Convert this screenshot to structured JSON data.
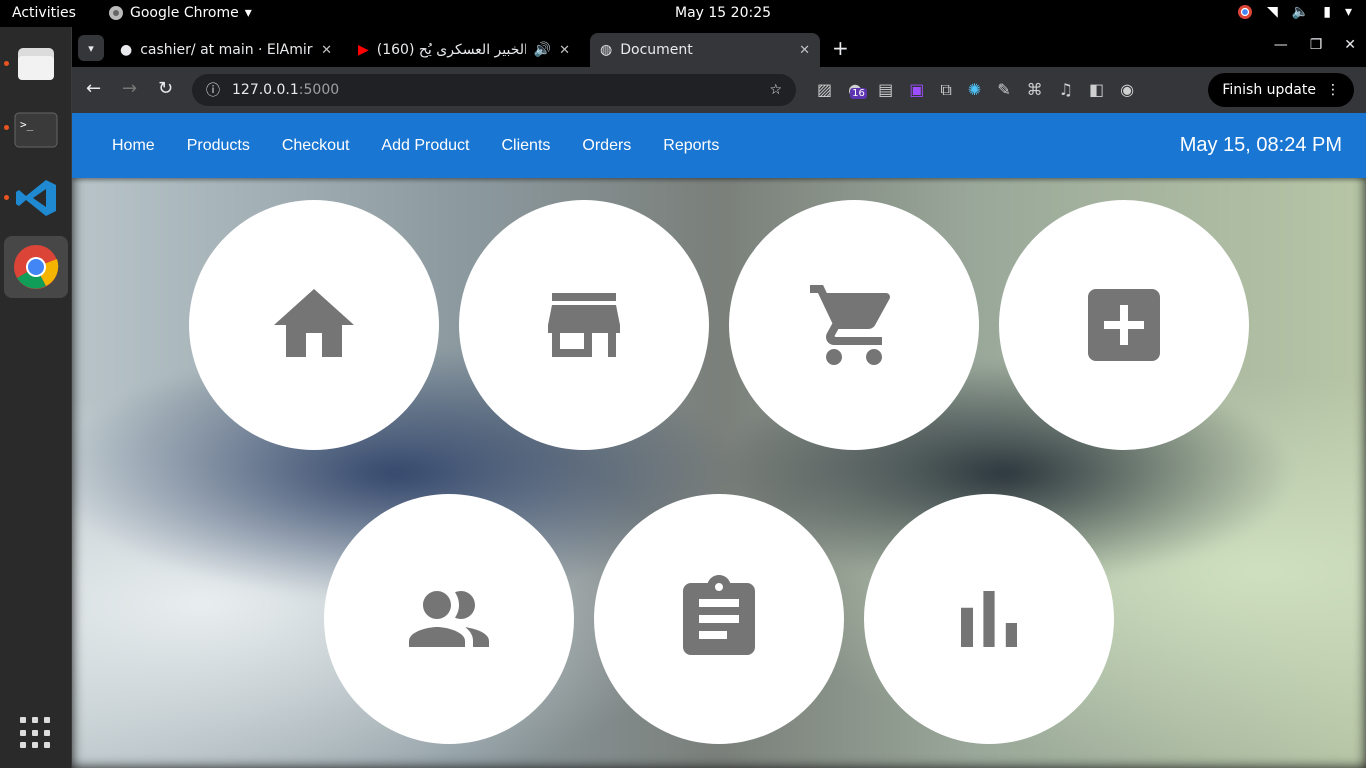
{
  "system": {
    "activities": "Activities",
    "app_name": "Google Chrome",
    "clock": "May 15  20:25"
  },
  "browser": {
    "tabs": [
      {
        "title": "cashier/ at main · ElAmir"
      },
      {
        "title": "(160) الخبير العسكرى يُح"
      },
      {
        "title": "Document"
      }
    ],
    "url_host": "127.0.0.1",
    "url_port": ":5000",
    "extension_badge": "16",
    "update_label": "Finish update"
  },
  "navbar": {
    "links": [
      "Home",
      "Products",
      "Checkout",
      "Add Product",
      "Clients",
      "Orders",
      "Reports"
    ],
    "datetime": "May 15, 08:24 PM"
  },
  "tiles": [
    {
      "icon": "home-icon"
    },
    {
      "icon": "store-icon"
    },
    {
      "icon": "cart-icon"
    },
    {
      "icon": "add-box-icon"
    },
    {
      "icon": "people-icon"
    },
    {
      "icon": "clipboard-icon"
    },
    {
      "icon": "bar-chart-icon"
    }
  ],
  "colors": {
    "navbar": "#1976d2",
    "icon": "#757575"
  }
}
